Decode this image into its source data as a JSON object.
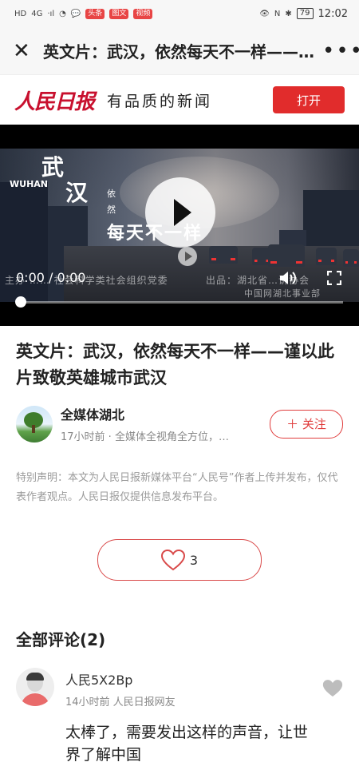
{
  "status_bar": {
    "left_items": [
      "HD",
      "4G",
      "·ıl",
      "◔",
      "💬",
      "头条",
      "图文",
      "视频"
    ],
    "right_items": [
      "👁",
      "N",
      "✱"
    ],
    "battery": "79",
    "time": "12:02"
  },
  "title_bar": {
    "close_glyph": "✕",
    "title": "英文片：武汉，依然每天不一样——…",
    "more_glyph": "•••"
  },
  "banner": {
    "logo_text": "人民日报",
    "slogan": "有品质的新闻",
    "open_label": "打开"
  },
  "video": {
    "overlay_title_1": "武",
    "overlay_title_2": "汉",
    "overlay_en": "WUHAN",
    "overlay_small_1": "依",
    "overlay_small_2": "然",
    "overlay_line": "每天不一样",
    "credits_left": "主办 …… 社会科学类社会组织党委",
    "credits_right_1": "出品：湖北省…讲协会",
    "credits_right_2": "中国网湖北事业部",
    "time_display": "0:00 / 0:00",
    "progress_fraction": 0.0
  },
  "article": {
    "title": "英文片：武汉，依然每天不一样——谨以此片致敬英雄城市武汉",
    "author_name": "全媒体湖北",
    "author_meta": "17小时前 · 全媒体全视角全方位，…",
    "follow_label": "＋ 关注",
    "disclaimer": "特别声明：本文为人民日报新媒体平台“人民号”作者上传并发布，仅代表作者观点。人民日报仅提供信息发布平台。"
  },
  "like": {
    "count": "3"
  },
  "comments": {
    "heading": "全部评论(2)",
    "items": [
      {
        "name": "人民5X2Bp",
        "meta": "14小时前  人民日报网友",
        "text": "太棒了，需要发出这样的声音，让世界了解中国"
      }
    ]
  },
  "colors": {
    "accent_red": "#e12c2c",
    "muted_text": "#9a9a9a"
  }
}
